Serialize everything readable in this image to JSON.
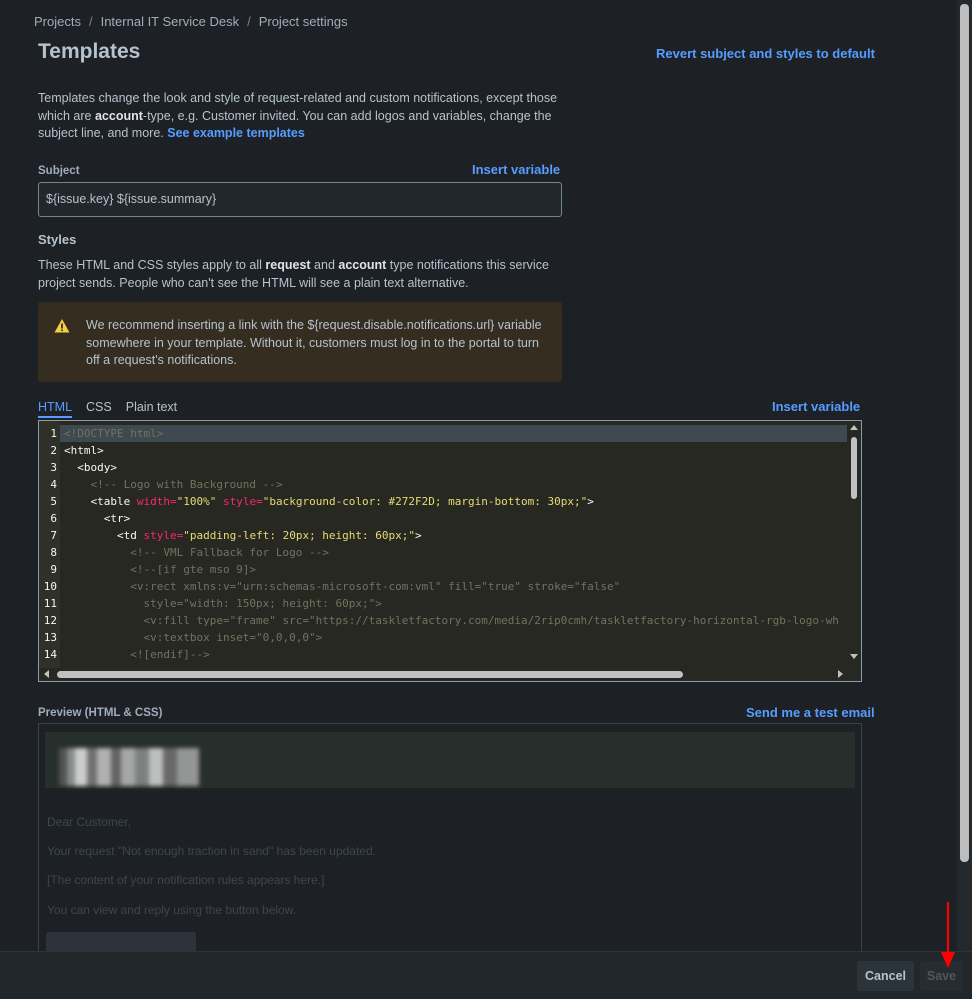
{
  "breadcrumb": {
    "items": [
      "Projects",
      "Internal IT Service Desk",
      "Project settings"
    ],
    "separator": "/"
  },
  "page": {
    "title": "Templates",
    "revert_link": "Revert subject and styles to default",
    "intro_part1": "Templates change the look and style of request-related and custom notifications, except those which are ",
    "intro_bold": "account",
    "intro_part2": "-type, e.g. Customer invited. You can add logos and variables, change the subject line, and more. ",
    "intro_link": "See example templates"
  },
  "subject": {
    "label": "Subject",
    "insert_variable": "Insert variable",
    "value": "${issue.key} ${issue.summary}"
  },
  "styles": {
    "heading": "Styles",
    "desc_part1": "These HTML and CSS styles apply to all ",
    "desc_bold1": "request",
    "desc_part2": " and ",
    "desc_bold2": "account",
    "desc_part3": " type notifications this service project sends. People who can't see the HTML will see a plain text alternative.",
    "warning": "We recommend inserting a link with the ${request.disable.notifications.url} variable somewhere in your template. Without it, customers must log in to the portal to turn off a request's notifications."
  },
  "editor_tabs": {
    "tabs": [
      "HTML",
      "CSS",
      "Plain text"
    ],
    "active": "HTML",
    "insert_variable": "Insert variable"
  },
  "code": {
    "lines": [
      {
        "n": "1",
        "segments": [
          {
            "t": "<!DOCTYPE html>",
            "c": "c-comment"
          }
        ]
      },
      {
        "n": "2",
        "segments": [
          {
            "t": "<html>",
            "c": "c-plain"
          }
        ]
      },
      {
        "n": "3",
        "segments": [
          {
            "t": "  <body>",
            "c": "c-plain"
          }
        ]
      },
      {
        "n": "4",
        "segments": [
          {
            "t": "    <!-- Logo with Background -->",
            "c": "c-comment"
          }
        ]
      },
      {
        "n": "5",
        "segments": [
          {
            "t": "    <table ",
            "c": "c-plain"
          },
          {
            "t": "width=",
            "c": "c-pink"
          },
          {
            "t": "\"100%\"",
            "c": "c-str"
          },
          {
            "t": " style=",
            "c": "c-pink"
          },
          {
            "t": "\"background-color: #272F2D; margin-bottom: 30px;\"",
            "c": "c-str"
          },
          {
            "t": ">",
            "c": "c-plain"
          }
        ]
      },
      {
        "n": "6",
        "segments": [
          {
            "t": "      <tr>",
            "c": "c-plain"
          }
        ]
      },
      {
        "n": "7",
        "segments": [
          {
            "t": "        <td ",
            "c": "c-plain"
          },
          {
            "t": "style=",
            "c": "c-pink"
          },
          {
            "t": "\"padding-left: 20px; height: 60px;\"",
            "c": "c-str"
          },
          {
            "t": ">",
            "c": "c-plain"
          }
        ]
      },
      {
        "n": "8",
        "segments": [
          {
            "t": "          <!-- VML Fallback for Logo -->",
            "c": "c-comment"
          }
        ]
      },
      {
        "n": "9",
        "segments": [
          {
            "t": "          <!--[if gte mso 9]>",
            "c": "c-comment"
          }
        ]
      },
      {
        "n": "10",
        "segments": [
          {
            "t": "          <v:rect xmlns:v=\"urn:schemas-microsoft-com:vml\" fill=\"true\" stroke=\"false\"",
            "c": "c-comment"
          }
        ]
      },
      {
        "n": "11",
        "segments": [
          {
            "t": "            style=\"width: 150px; height: 60px;\">",
            "c": "c-comment"
          }
        ]
      },
      {
        "n": "12",
        "segments": [
          {
            "t": "            <v:fill type=\"frame\" src=\"https://taskletfactory.com/media/2rip0cmh/taskletfactory-horizontal-rgb-logo-wh",
            "c": "c-comment"
          }
        ]
      },
      {
        "n": "13",
        "segments": [
          {
            "t": "            <v:textbox inset=\"0,0,0,0\">",
            "c": "c-comment"
          }
        ]
      },
      {
        "n": "14",
        "segments": [
          {
            "t": "          <![endif]-->",
            "c": "c-comment"
          }
        ]
      }
    ]
  },
  "preview": {
    "label": "Preview (HTML & CSS)",
    "send_test": "Send me a test email",
    "greeting": "Dear Customer,",
    "line1": "Your request \"Not enough traction in sand\" has been updated.",
    "line2": "[The content of your notification rules appears here.]",
    "line3": "You can view and reply using the button below."
  },
  "footer": {
    "cancel": "Cancel",
    "save": "Save"
  },
  "colors": {
    "background": "#1d2125",
    "link": "#579dff",
    "warning_bg": "#342d20",
    "warning_icon": "#f5cd47",
    "annotation_arrow": "#ff0000"
  }
}
